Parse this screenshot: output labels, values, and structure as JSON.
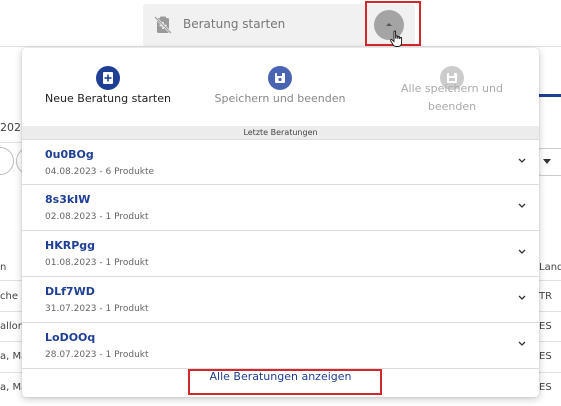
{
  "topbar": {
    "label": "Beratung starten",
    "icon": "consultation-off-icon",
    "expand_icon": "chevron-up-icon"
  },
  "actions": [
    {
      "label": "Neue Beratung starten",
      "icon": "plus-document-icon",
      "state": "active",
      "color": "#1f3f94"
    },
    {
      "label": "Speichern und beenden",
      "icon": "save-icon",
      "state": "enabled",
      "color": "#4a64b3"
    },
    {
      "label": "Alle speichern und beenden",
      "icon": "save-all-icon",
      "state": "disabled",
      "color": "#cccccc"
    }
  ],
  "recent_header": "Letzte Beratungen",
  "recent": [
    {
      "code": "0u0BOg",
      "meta": "04.08.2023 - 6 Produkte"
    },
    {
      "code": "8s3kIW",
      "meta": "02.08.2023 - 1 Produkt"
    },
    {
      "code": "HKRPgg",
      "meta": "01.08.2023 - 1 Produkt"
    },
    {
      "code": "DLf7WD",
      "meta": "31.07.2023 - 1 Produkt"
    },
    {
      "code": "LoDOOq",
      "meta": "28.07.2023 - 1 Produkt"
    }
  ],
  "footer_link": "Alle Beratungen anzeigen",
  "background": {
    "year_fragment": "202",
    "column_fragment": "n",
    "right_column_header": "Land",
    "rows": [
      {
        "left": "che F",
        "right": "TR"
      },
      {
        "left": "allor",
        "right": "ES"
      },
      {
        "left": "a, Ma",
        "right": "ES"
      },
      {
        "left": "a, Ma",
        "right": "ES"
      }
    ]
  },
  "colors": {
    "accent": "#1f3f94",
    "highlight": "#d3272e",
    "topbar_bg": "#f1f1f1",
    "separator_bg": "#ececec"
  }
}
